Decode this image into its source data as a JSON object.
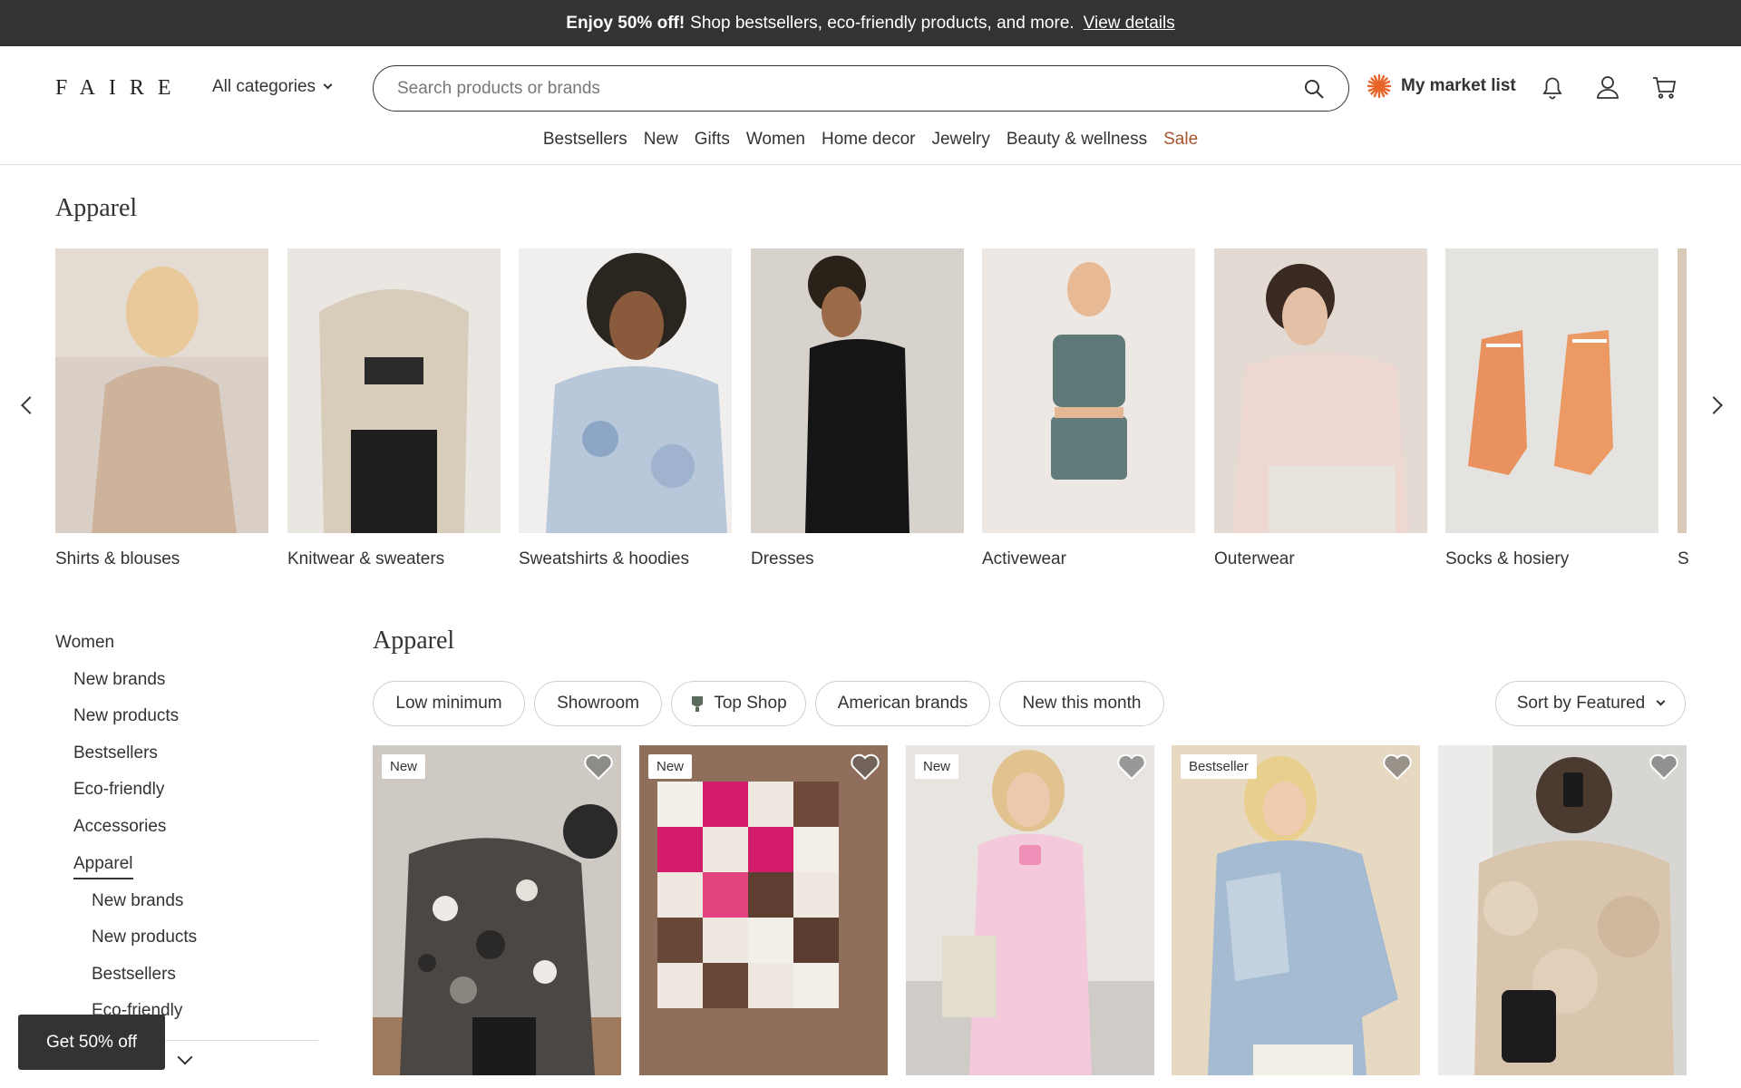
{
  "promo": {
    "bold": "Enjoy 50% off!",
    "text": "Shop bestsellers, eco-friendly products, and more.",
    "link": "View details"
  },
  "header": {
    "logo": "FAIRE",
    "all_categories": "All categories",
    "search_placeholder": "Search products or brands",
    "market_list": "My market list",
    "icons": [
      "bell-icon",
      "user-icon",
      "cart-icon"
    ]
  },
  "nav": [
    "Bestsellers",
    "New",
    "Gifts",
    "Women",
    "Home decor",
    "Jewelry",
    "Beauty & wellness",
    "Sale"
  ],
  "categories_section": {
    "title": "Apparel",
    "items": [
      "Shirts & blouses",
      "Knitwear & sweaters",
      "Sweatshirts & hoodies",
      "Dresses",
      "Activewear",
      "Outerwear",
      "Socks & hosiery",
      "S"
    ]
  },
  "sidebar": {
    "root": "Women",
    "items": [
      "New brands",
      "New products",
      "Bestsellers",
      "Eco-friendly",
      "Accessories"
    ],
    "active": "Apparel",
    "subitems": [
      "New brands",
      "New products",
      "Bestsellers",
      "Eco-friendly"
    ]
  },
  "products_section": {
    "title": "Apparel",
    "filters": [
      "Low minimum",
      "Showroom",
      "Top Shop",
      "American brands",
      "New this month"
    ],
    "sort": "Sort by Featured",
    "badges": [
      "New",
      "New",
      "New",
      "Bestseller",
      ""
    ]
  },
  "floating": {
    "get_off": "Get 50% off"
  },
  "colors": {
    "banner": "#333333",
    "sale": "#a5542d",
    "market_icon": "#e8652a"
  }
}
